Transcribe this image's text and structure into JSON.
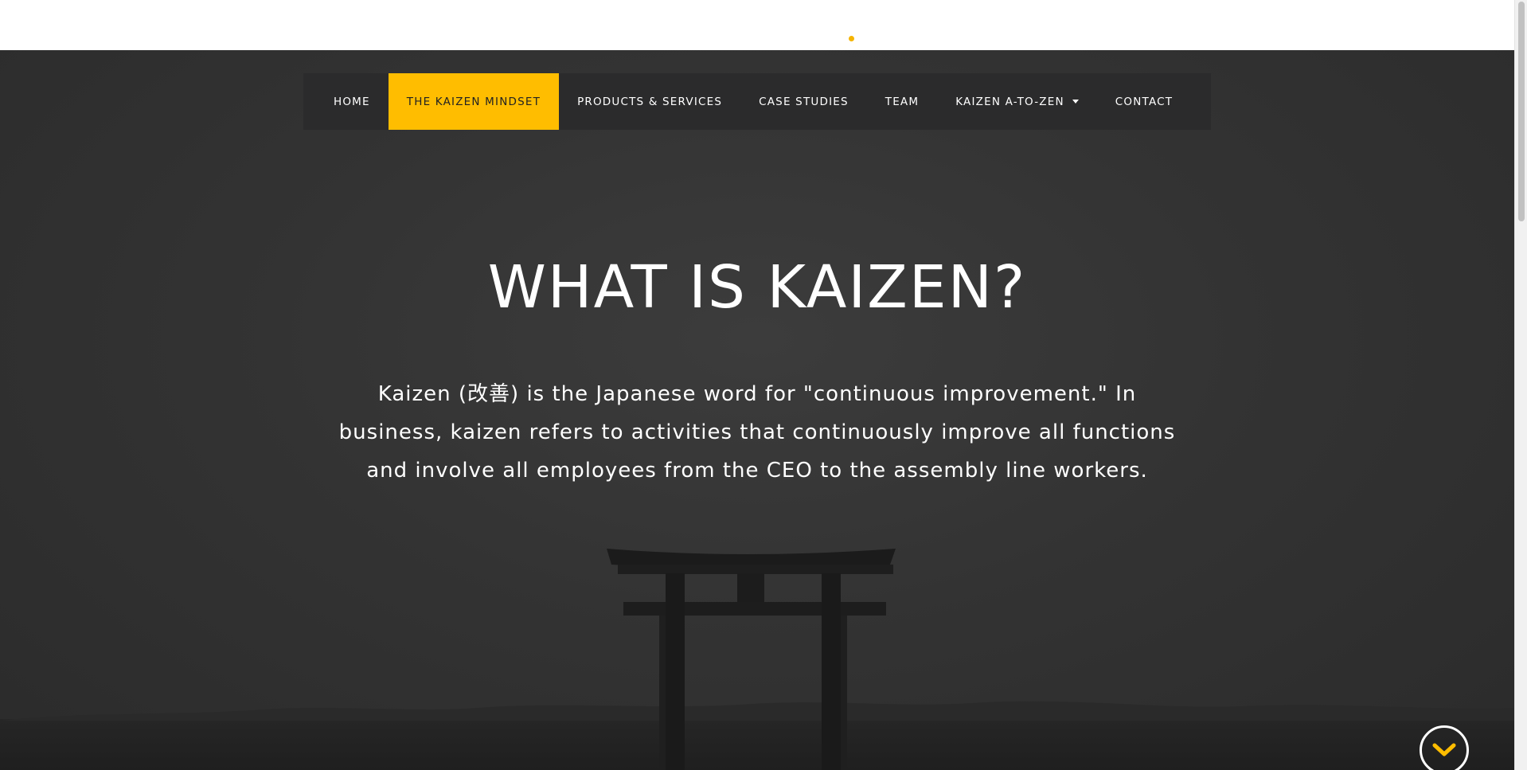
{
  "nav": {
    "items": [
      {
        "label": "HOME"
      },
      {
        "label": "THE KAIZEN MINDSET",
        "active": true
      },
      {
        "label": "PRODUCTS & SERVICES"
      },
      {
        "label": "CASE STUDIES"
      },
      {
        "label": "TEAM"
      },
      {
        "label": "KAIZEN A-TO-ZEN",
        "has_dropdown": true
      },
      {
        "label": "CONTACT"
      }
    ]
  },
  "hero": {
    "title": "WHAT IS KAIZEN?",
    "intro": "Kaizen (改善) is the Japanese word for \"continuous improvement.\" In business, kaizen refers to activities that continuously improve all functions and involve all employees from the CEO to the assembly line workers."
  },
  "icons": {
    "scroll_down": "chevron-down-icon",
    "dropdown": "caret-down-icon",
    "background": "torii-gate"
  },
  "colors": {
    "accent": "#ffbd00",
    "nav_background": "#2b2b2c",
    "hero_background": "#333333",
    "text": "#ffffff"
  }
}
